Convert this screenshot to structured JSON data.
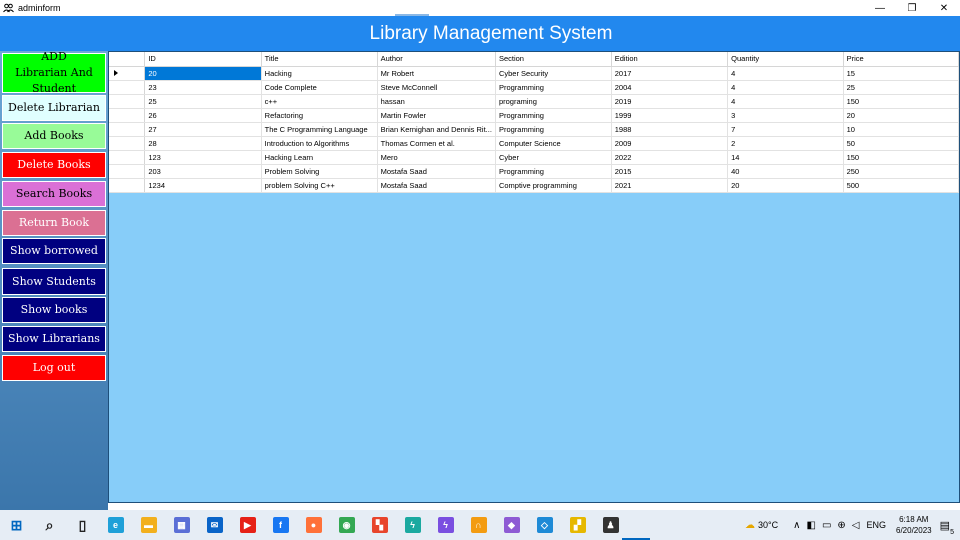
{
  "window": {
    "title": "adminform",
    "controls": [
      "—",
      "❐",
      "✕"
    ]
  },
  "header": {
    "title": "Library Management System"
  },
  "sidebar": {
    "buttons": [
      {
        "label": "ADD Librarian And Student",
        "bg": "#00ff00",
        "fg": "#000000"
      },
      {
        "label": "Delete Librarian",
        "bg": "#e0ffff",
        "fg": "#000000"
      },
      {
        "label": "Add Books",
        "bg": "#98fb98",
        "fg": "#000000"
      },
      {
        "label": "Delete Books",
        "bg": "#ff0000",
        "fg": "#ffffff"
      },
      {
        "label": "Search Books",
        "bg": "#da70d6",
        "fg": "#000000"
      },
      {
        "label": "Return Book",
        "bg": "#db7093",
        "fg": "#ffffff"
      },
      {
        "label": "Show borrowed",
        "bg": "#000080",
        "fg": "#ffffff"
      },
      {
        "label": "Show Students",
        "bg": "#000080",
        "fg": "#ffffff"
      },
      {
        "label": "Show books",
        "bg": "#000080",
        "fg": "#ffffff"
      },
      {
        "label": "Show Librarians",
        "bg": "#000080",
        "fg": "#ffffff"
      },
      {
        "label": "Log out",
        "bg": "#ff0000",
        "fg": "#ffffff"
      }
    ]
  },
  "grid": {
    "columns": [
      "ID",
      "Title",
      "Author",
      "Section",
      "Edition",
      "Quantity",
      "Price"
    ],
    "selected_row": 0,
    "rows": [
      [
        "20",
        "Hacking",
        "Mr Robert",
        "Cyber Security",
        "2017",
        "4",
        "15"
      ],
      [
        "23",
        "Code Complete",
        "Steve McConnell",
        "Programming",
        "2004",
        "4",
        "25"
      ],
      [
        "25",
        "c++",
        "hassan",
        "programing",
        "2019",
        "4",
        "150"
      ],
      [
        "26",
        "Refactoring",
        "Martin Fowler",
        "Programming",
        "1999",
        "3",
        "20"
      ],
      [
        "27",
        "The C Programming Language",
        "Brian Kernighan and Dennis Rit...",
        "Programming",
        "1988",
        "7",
        "10"
      ],
      [
        "28",
        "Introduction to Algorithms",
        "Thomas Cormen et al.",
        "Computer Science",
        "2009",
        "2",
        "50"
      ],
      [
        "123",
        "Hacking Learn",
        "Mero",
        "Cyber",
        "2022",
        "14",
        "150"
      ],
      [
        "203",
        "Problem Solving",
        "Mostafa Saad",
        "Programming",
        "2015",
        "40",
        "250"
      ],
      [
        "1234",
        "problem Solving C++",
        " Mostafa Saad",
        "Comptive programming",
        "2021",
        "20",
        "500"
      ]
    ]
  },
  "taskbar": {
    "apps": [
      {
        "name": "windows-start-icon",
        "glyph": "⊞",
        "color": "#0067c0"
      },
      {
        "name": "search-icon",
        "glyph": "⌕",
        "color": "#222222"
      },
      {
        "name": "task-view-icon",
        "glyph": "▯",
        "color": "#222222"
      },
      {
        "name": "edge-icon",
        "glyph": "e",
        "color": "#1fa0d8"
      },
      {
        "name": "file-explorer-icon",
        "glyph": "▬",
        "color": "#f2b01e"
      },
      {
        "name": "store-icon",
        "glyph": "▦",
        "color": "#5b6fd6"
      },
      {
        "name": "mail-icon",
        "glyph": "✉",
        "color": "#0a64c8"
      },
      {
        "name": "youtube-icon",
        "glyph": "▶",
        "color": "#e62117"
      },
      {
        "name": "facebook-icon",
        "glyph": "f",
        "color": "#1877f2"
      },
      {
        "name": "firefox-icon",
        "glyph": "●",
        "color": "#ff7139"
      },
      {
        "name": "chrome-icon",
        "glyph": "◉",
        "color": "#34a853"
      },
      {
        "name": "tiles-app-icon",
        "glyph": "▚",
        "color": "#e8452c"
      },
      {
        "name": "bolt-app-icon",
        "glyph": "ϟ",
        "color": "#1ba9a0"
      },
      {
        "name": "bolt-purple-app-icon",
        "glyph": "ϟ",
        "color": "#7a4fe0"
      },
      {
        "name": "arc-app-icon",
        "glyph": "∩",
        "color": "#f39c12"
      },
      {
        "name": "visual-studio-icon",
        "glyph": "◆",
        "color": "#8e5bd4"
      },
      {
        "name": "vscode-icon",
        "glyph": "◇",
        "color": "#1e8ad6"
      },
      {
        "name": "sticky-app-icon",
        "glyph": "▞",
        "color": "#e6b800"
      },
      {
        "name": "people-app-icon",
        "glyph": "♟",
        "color": "#333333"
      }
    ],
    "weather": "30°C",
    "language": "ENG",
    "time": "6:18 AM",
    "date": "6/20/2023",
    "notifications": "5"
  }
}
